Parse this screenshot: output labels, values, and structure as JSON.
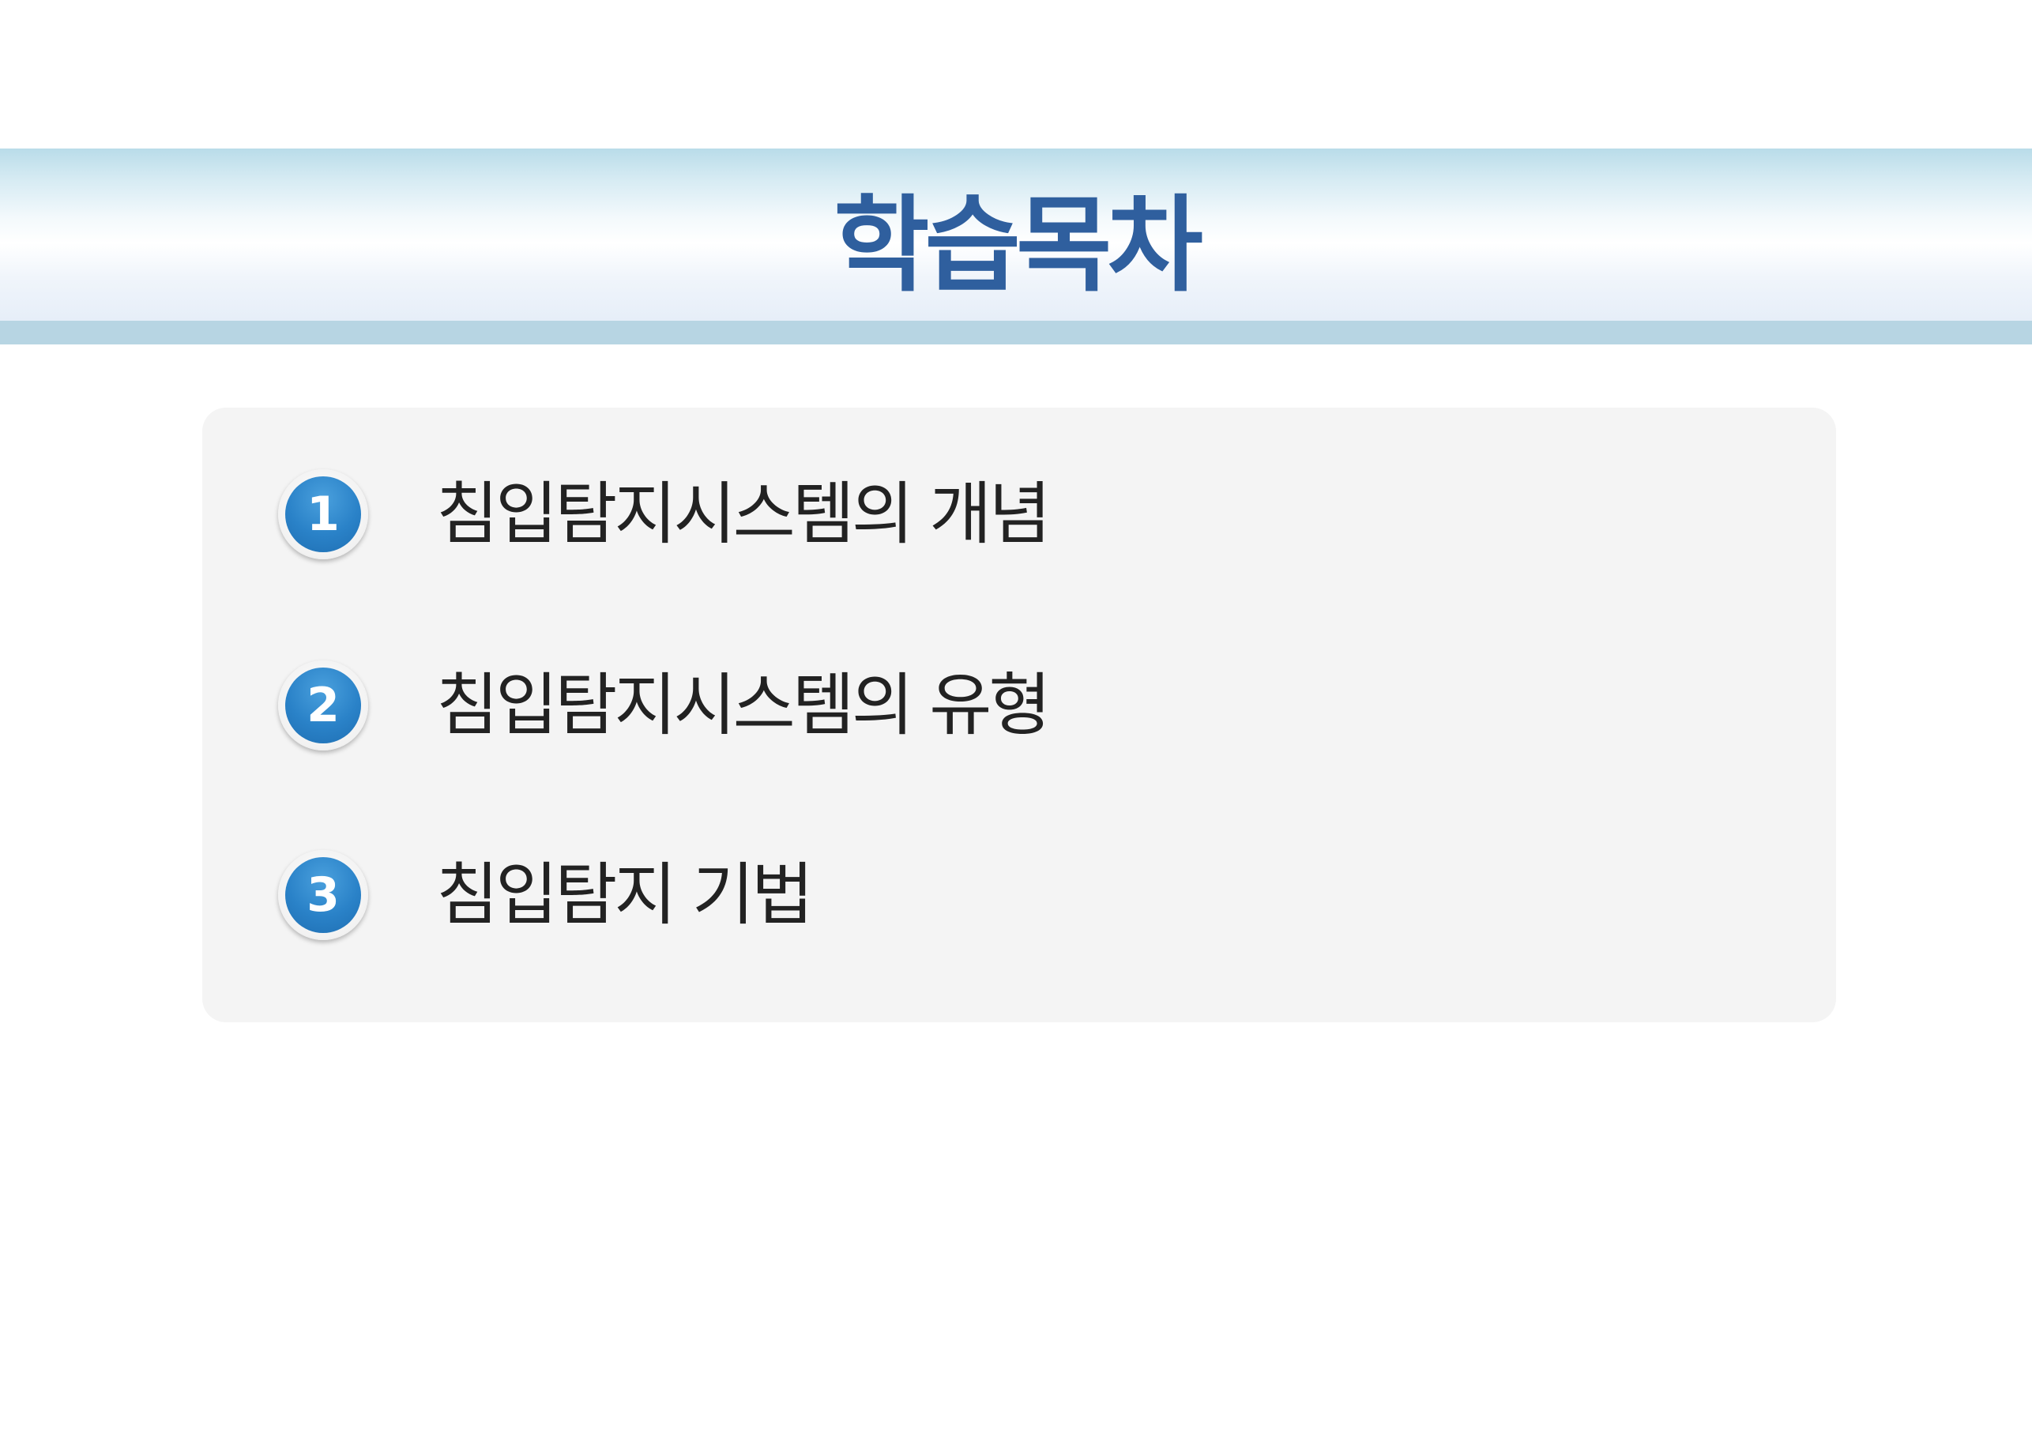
{
  "header": {
    "title": "학습목차"
  },
  "toc": {
    "items": [
      {
        "number": "1",
        "label": "침입탐지시스템의 개념"
      },
      {
        "number": "2",
        "label": "침입탐지시스템의 유형"
      },
      {
        "number": "3",
        "label": "침입탐지 기법"
      }
    ]
  },
  "colors": {
    "title": "#2f5f9e",
    "badge": "#2a82c8",
    "panel": "#f4f4f4",
    "band_stripe": "#b7d5e3"
  }
}
